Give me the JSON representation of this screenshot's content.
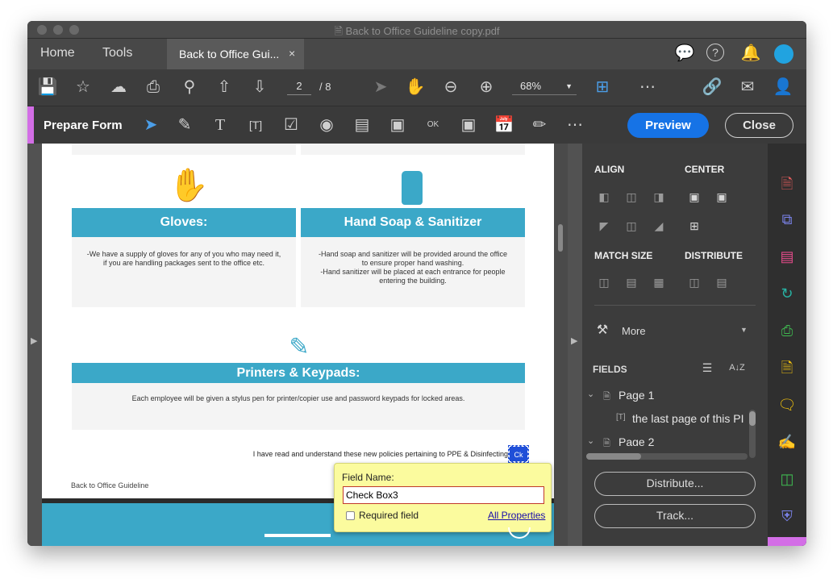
{
  "window": {
    "title": "Back to Office Guideline copy.pdf"
  },
  "tabs": {
    "home": "Home",
    "tools": "Tools",
    "doc": "Back to Office Gui...",
    "close": "×"
  },
  "toolbar": {
    "page_current": "2",
    "page_total": "/ 8",
    "zoom": "68%"
  },
  "formbar": {
    "title": "Prepare Form",
    "preview": "Preview",
    "close": "Close"
  },
  "document": {
    "cards": [
      {
        "title": "Gloves:",
        "text": "-We have a supply of gloves for any of you who may need it,\nif you are handling packages sent to the office etc."
      },
      {
        "title": "Hand Soap & Sanitizer",
        "text": "-Hand soap and sanitizer will be provided around the office\nto ensure proper hand washing.\n-Hand sanitizer will be placed at each entrance for people\nentering the building."
      },
      {
        "title": "Printers & Keypads:",
        "text": "Each employee will be given a stylus pen for printer/copier use and password keypads for locked areas."
      }
    ],
    "acknowledge": "I have read and understand these new policies pertaining to PPE & Disinfecting",
    "checkbox_tag": "Ck",
    "footer": "Back to Office Guideline"
  },
  "popup": {
    "label": "Field Name:",
    "value": "Check Box3",
    "required": "Required field",
    "all_props": "All Properties"
  },
  "panel": {
    "align": "ALIGN",
    "center": "CENTER",
    "match_size": "MATCH SIZE",
    "distribute": "DISTRIBUTE",
    "more": "More",
    "fields": "FIELDS",
    "tree": [
      {
        "label": "Page 1"
      },
      {
        "label": "the last page of this PI"
      },
      {
        "label": "Page 2"
      }
    ],
    "distribute_btn": "Distribute...",
    "track_btn": "Track..."
  },
  "colors": {
    "accent": "#d36ee6",
    "brand_blue": "#1673e6",
    "card_header": "#3ba8c8",
    "popup_bg": "#fbfb9e"
  }
}
